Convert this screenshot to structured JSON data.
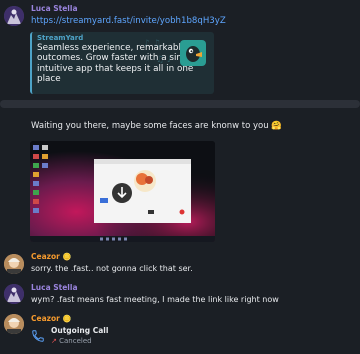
{
  "messages": {
    "m1": {
      "sender": "Luca Stella",
      "link_text": "https://streamyard.fast/invite/yobh1b8qH3yZ",
      "preview": {
        "site": "StreamYard",
        "description": "Seamless experience, remarkable outcomes. Grow faster with a simple, intuitive app that keeps it all in one place"
      }
    },
    "m2": {
      "text": "Waiting you there, maybe some faces are knonw to you 🤗"
    },
    "m3": {
      "sender": "Ceazor",
      "sender_badge": "🪙",
      "text": "sorry. the .fast.. not gonna click that ser."
    },
    "m4": {
      "sender": "Luca Stella",
      "text": "wym? .fast means fast meeting, I made the link like right now"
    },
    "m5": {
      "sender": "Ceazor",
      "sender_badge": "🪙",
      "call_title": "Outgoing Call",
      "call_status": "Canceled",
      "call_status_icon": "↗"
    }
  },
  "colors": {
    "background": "#1b1f25",
    "luca_name": "#9a84de",
    "ceazor_name": "#f59a2e",
    "link": "#5ea6ff",
    "preview_accent": "#4ea3c7",
    "canceled": "#e05252"
  }
}
